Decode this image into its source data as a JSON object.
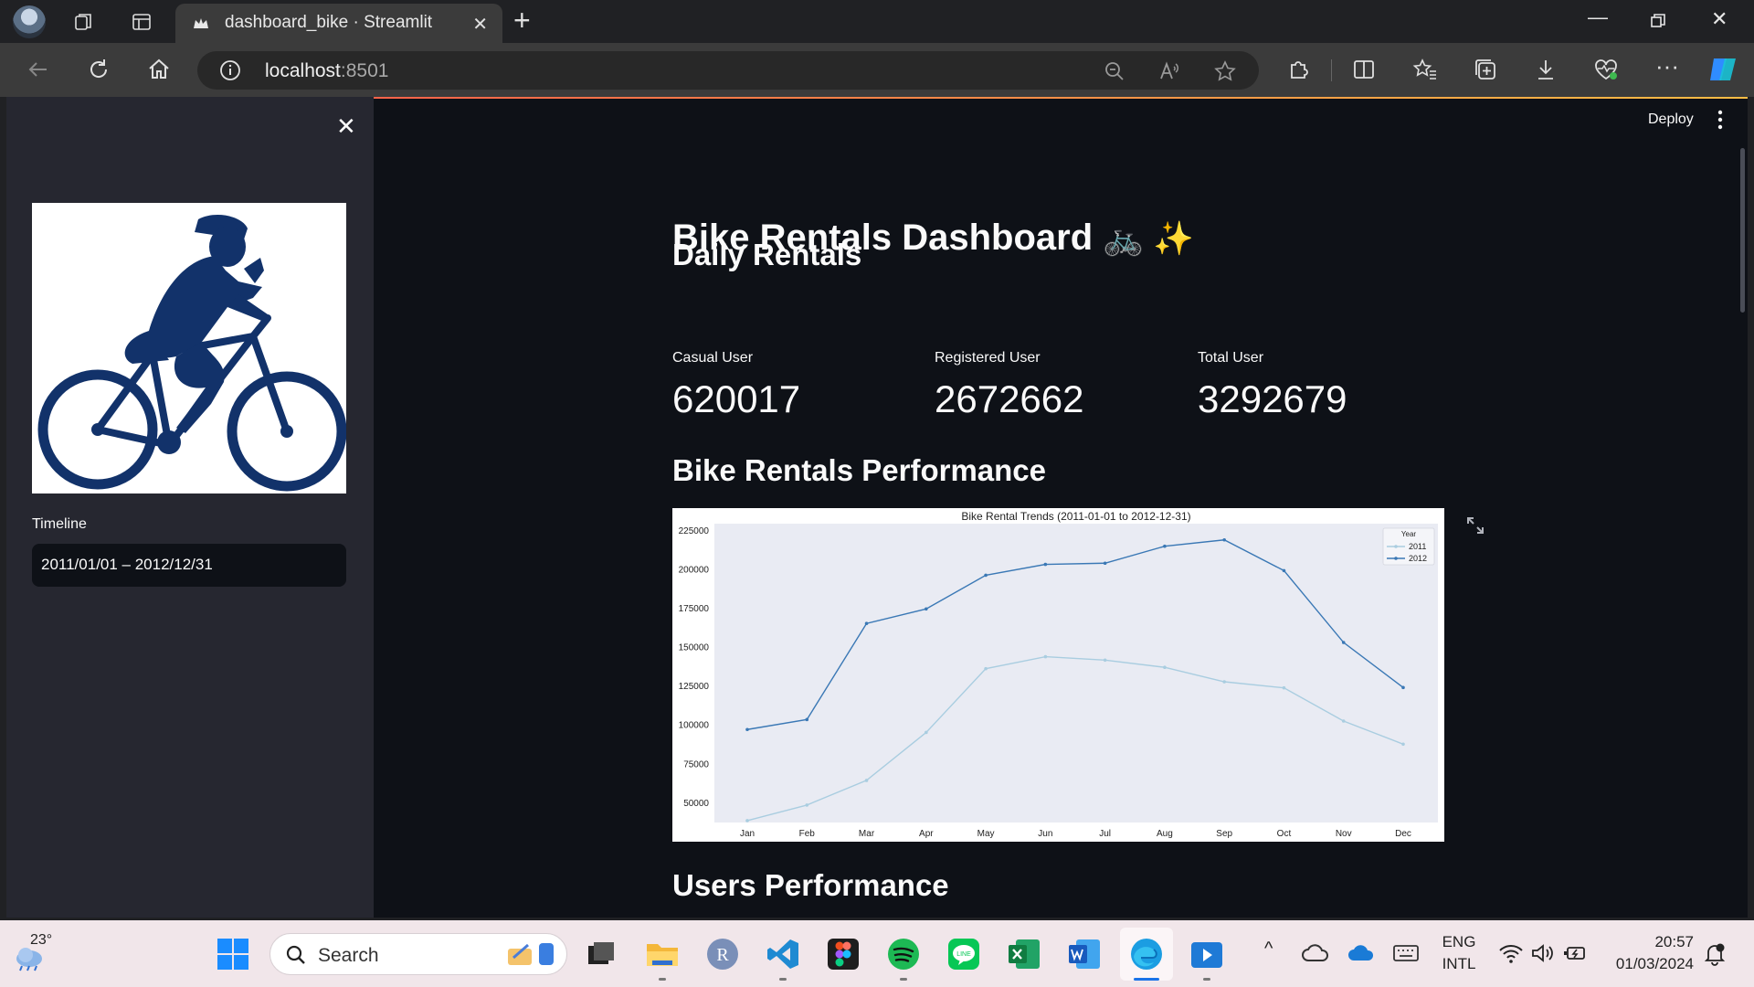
{
  "browser": {
    "tab_title": "dashboard_bike · Streamlit",
    "url_host": "localhost",
    "url_port": ":8501"
  },
  "sidebar": {
    "timeline_label": "Timeline",
    "date_range": "2011/01/01 – 2012/12/31"
  },
  "header": {
    "deploy_label": "Deploy"
  },
  "main": {
    "title": "Bike Rentals Dashboard",
    "title_emoji": "🚲 ✨",
    "section_daily": "Daily Rentals",
    "metrics": [
      {
        "label": "Casual User",
        "value": "620017"
      },
      {
        "label": "Registered User",
        "value": "2672662"
      },
      {
        "label": "Total User",
        "value": "3292679"
      }
    ],
    "section_performance": "Bike Rentals Performance",
    "section_users": "Users Performance"
  },
  "chart_data": {
    "type": "line",
    "title": "Bike Rental Trends (2011-01-01 to 2012-12-31)",
    "xlabel": "",
    "ylabel": "",
    "categories": [
      "Jan",
      "Feb",
      "Mar",
      "Apr",
      "May",
      "Jun",
      "Jul",
      "Aug",
      "Sep",
      "Oct",
      "Nov",
      "Dec"
    ],
    "yticks": [
      50000,
      75000,
      100000,
      125000,
      150000,
      175000,
      200000,
      225000
    ],
    "ylim": [
      37000,
      229000
    ],
    "legend_title": "Year",
    "legend_position": "top-right",
    "grid": false,
    "series": [
      {
        "name": "2011",
        "color": "#a9cde0",
        "values": [
          38189,
          48215,
          64045,
          94870,
          135821,
          143512,
          141341,
          136691,
          127418,
          123511,
          102167,
          87323
        ]
      },
      {
        "name": "2012",
        "color": "#3a78b5",
        "values": [
          96744,
          103137,
          164875,
          174224,
          195865,
          202830,
          203607,
          214503,
          218573,
          198841,
          152664,
          123713
        ]
      }
    ]
  },
  "taskbar": {
    "temperature": "23°",
    "search_placeholder": "Search",
    "lang_top": "ENG",
    "lang_bottom": "INTL",
    "time": "20:57",
    "date": "01/03/2024"
  }
}
